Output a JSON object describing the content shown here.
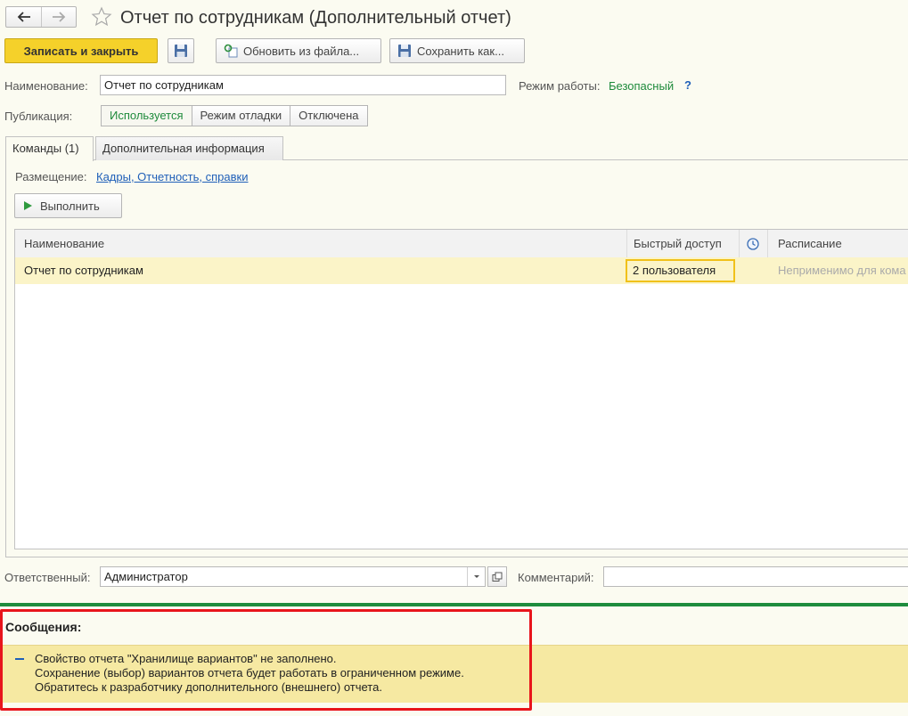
{
  "window": {
    "title": "Отчет по сотрудникам (Дополнительный отчет)"
  },
  "nav": {
    "back_icon": "arrow-left-icon",
    "forward_icon": "arrow-right-icon",
    "favorite_icon": "star-outline-icon"
  },
  "toolbar": {
    "save_close_label": "Записать и закрыть",
    "save_icon": "floppy-disk-icon",
    "update_from_file_label": "Обновить из файла...",
    "save_as_label": "Сохранить как..."
  },
  "form": {
    "name_label": "Наименование:",
    "name_value": "Отчет по сотрудникам",
    "mode_label": "Режим работы:",
    "mode_value": "Безопасный",
    "mode_help": "?",
    "publication_label": "Публикация:",
    "publication_options": [
      "Используется",
      "Режим отладки",
      "Отключена"
    ],
    "publication_selected": "Используется"
  },
  "tabs": [
    {
      "label": "Команды (1)",
      "active": true
    },
    {
      "label": "Дополнительная информация",
      "active": false
    }
  ],
  "commands": {
    "placement_label": "Размещение:",
    "placement_value": "Кадры, Отчетность, справки",
    "run_label": "Выполнить",
    "table": {
      "columns": [
        "Наименование",
        "Быстрый доступ",
        "clock-icon",
        "Расписание"
      ],
      "rows": [
        {
          "name": "Отчет по сотрудникам",
          "quick_access": "2 пользователя",
          "schedule": "Неприменимо для кома"
        }
      ]
    }
  },
  "footer": {
    "responsible_label": "Ответственный:",
    "responsible_value": "Администратор",
    "comment_label": "Комментарий:",
    "comment_value": ""
  },
  "messages": {
    "title": "Сообщения:",
    "lines": [
      "Свойство отчета \"Хранилище вариантов\" не заполнено.",
      "Сохранение (выбор) вариантов отчета будет работать в ограниченном режиме.",
      "Обратитесь к разработчику дополнительного (внешнего) отчета."
    ]
  },
  "colors": {
    "accent_yellow": "#f5d12a",
    "link_blue": "#1f5fb8",
    "green_text": "#1e8a3b",
    "highlight_red": "#e8141b",
    "message_bg": "#f6e9a2",
    "separator_green": "#1e8c3e"
  }
}
